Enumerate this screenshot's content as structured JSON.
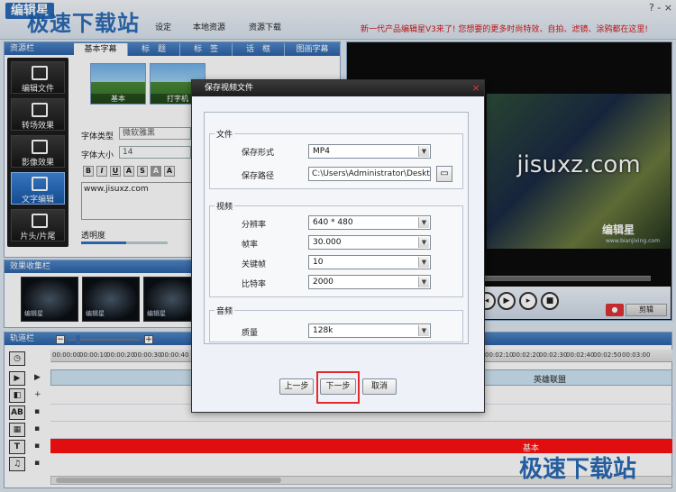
{
  "app": {
    "logo": "编辑星",
    "watermark": "极速下载站",
    "window_controls": "? -  ×",
    "toolbar": [
      "设定",
      "本地资源",
      "资源下载"
    ],
    "marquee": "新一代产品编辑星V3来了! 您想要的更多时尚特效、自拍、滤镜、涂鸦都在这里!"
  },
  "left_panel": {
    "header": "资源栏",
    "tabs": [
      "基本字幕",
      "标　题",
      "标　签",
      "话　框",
      "图画字幕"
    ],
    "side_buttons": [
      "编辑文件",
      "转场效果",
      "影像效果",
      "文字编辑",
      "片头/片尾"
    ],
    "active_side": "文字编辑",
    "thumbs": [
      "基本",
      "打字机"
    ],
    "font_type_label": "字体类型",
    "font_type_value": "微软雅黑",
    "font_size_label": "字体大小",
    "font_size_value": "14",
    "format_buttons": [
      "B",
      "I",
      "U",
      "A",
      "S",
      "A",
      "A"
    ],
    "text_content": "www.jisuxz.com",
    "opacity_label": "透明度",
    "opacity_value": 0.52
  },
  "effects_panel": {
    "header": "效果收集栏",
    "item_tag": "编辑星"
  },
  "preview": {
    "video_text": "jisuxz.com",
    "video_logo": "编辑星",
    "video_site": "www.bianjixing.com",
    "cut_label": "剪辑",
    "rec_label": "●"
  },
  "timeline": {
    "header": "轨道栏",
    "zoom_minus": "−",
    "zoom_plus": "+",
    "ticks": [
      "00:00:00",
      "00:00:10",
      "00:00:20",
      "00:00:30",
      "00:00:40",
      "00:02:10",
      "00:02:20",
      "00:02:30",
      "00:02:40",
      "00:02:50",
      "00:03:00"
    ],
    "main_track_label": "英雄联盟",
    "text_track_label": "基本",
    "track_icons": [
      "◷",
      "▶",
      "◧",
      "AB",
      "▦",
      "T",
      "♫"
    ]
  },
  "dialog": {
    "title": "保存视频文件",
    "close": "×",
    "file_group": "文件",
    "save_format_label": "保存形式",
    "save_format_value": "MP4",
    "save_path_label": "保存路径",
    "save_path_value": "C:\\Users\\Administrator\\Deskto",
    "video_group": "视频",
    "resolution_label": "分辨率",
    "resolution_value": "640 * 480",
    "fps_label": "帧率",
    "fps_value": "30.000",
    "keyframe_label": "关键帧",
    "keyframe_value": "10",
    "bitrate_label": "比特率",
    "bitrate_value": "2000",
    "audio_group": "音频",
    "quality_label": "质量",
    "quality_value": "128k",
    "prev_label": "上一步",
    "next_label": "下一步",
    "cancel_label": "取消",
    "dropdown_arrow": "▼",
    "folder_icon": "▭"
  }
}
